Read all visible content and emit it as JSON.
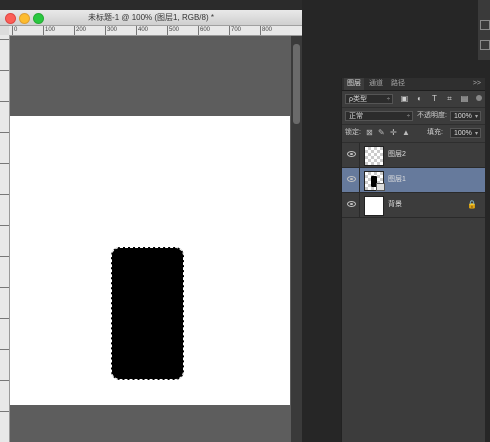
{
  "document": {
    "title": "未标题-1 @ 100% (图层1, RGB/8) *",
    "ruler_ticks": [
      "0",
      "100",
      "200",
      "300",
      "400",
      "500",
      "600",
      "700",
      "800"
    ]
  },
  "layers_panel": {
    "tabs": [
      "图层",
      "通道",
      "路径"
    ],
    "active_tab": "图层",
    "menu_icon": ">>",
    "filter": {
      "value": "ρ类型",
      "arrow": "÷"
    },
    "blend_mode": {
      "value": "正常",
      "arrow": "÷"
    },
    "opacity": {
      "label": "不透明度:",
      "value": "100%",
      "arrow": "▾"
    },
    "lock": {
      "label": "锁定:"
    },
    "fill": {
      "label": "填充:",
      "value": "100%",
      "arrow": "▾"
    },
    "layers": [
      {
        "name": "图层2",
        "thumb": "transparent",
        "selected": false,
        "locked": false
      },
      {
        "name": "图层1",
        "thumb": "shape",
        "selected": true,
        "locked": false
      },
      {
        "name": "背景",
        "thumb": "white",
        "selected": false,
        "locked": true
      }
    ]
  },
  "icons": {
    "filter_icons": [
      "image-filter-icon",
      "adjustment-filter-icon",
      "text-filter-icon",
      "shape-filter-icon",
      "smart-object-filter-icon"
    ],
    "lock_icons": [
      "lock-transparent-icon",
      "lock-brush-icon",
      "lock-move-icon",
      "lock-all-icon"
    ],
    "lock_glyph": "🔒"
  }
}
